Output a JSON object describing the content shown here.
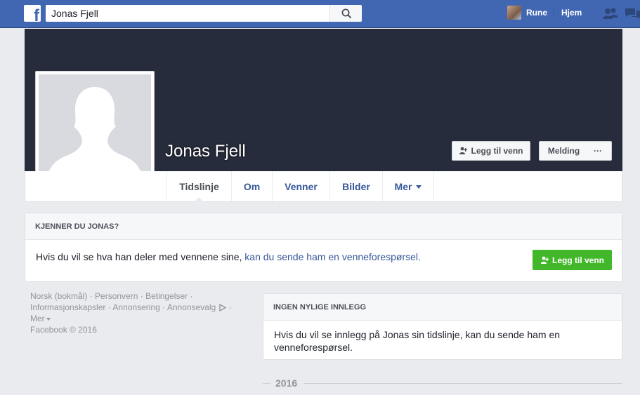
{
  "topbar": {
    "logo": "f",
    "search_value": "Jonas Fjell",
    "search_icon": "search-icon",
    "user_name": "Rune",
    "home_label": "Hjem",
    "friends_icon": "friend-requests-icon",
    "messages_icon": "messages-icon"
  },
  "profile": {
    "name": "Jonas Fjell",
    "add_friend_label": "Legg til venn",
    "message_label": "Melding",
    "more_label": "···"
  },
  "nav": {
    "tabs": [
      {
        "label": "Tidslinje",
        "active": true
      },
      {
        "label": "Om"
      },
      {
        "label": "Venner"
      },
      {
        "label": "Bilder"
      },
      {
        "label": "Mer"
      }
    ]
  },
  "know_card": {
    "title": "KJENNER DU JONAS?",
    "text_plain": "Hvis du vil se hva han deler med vennene sine, ",
    "text_link": "kan du sende ham en venneforespørsel.",
    "button_label": "Legg til venn"
  },
  "footer": {
    "links": [
      "Norsk (bokmål)",
      "Personvern",
      "Betingelser",
      "Informasjonskapsler",
      "Annonsering",
      "Annonsevalg",
      "Mer"
    ],
    "copyright": "Facebook © 2016"
  },
  "posts_card": {
    "title": "INGEN NYLIGE INNLEGG",
    "text": "Hvis du vil se innlegg på Jonas sin tidslinje, kan du sende ham en venneforespørsel."
  },
  "timeline": {
    "year": "2016"
  },
  "colors": {
    "brand_blue": "#4267b2",
    "cover": "#272c3c",
    "link": "#365899",
    "green_button": "#42b72a",
    "background": "#e9ebee"
  }
}
